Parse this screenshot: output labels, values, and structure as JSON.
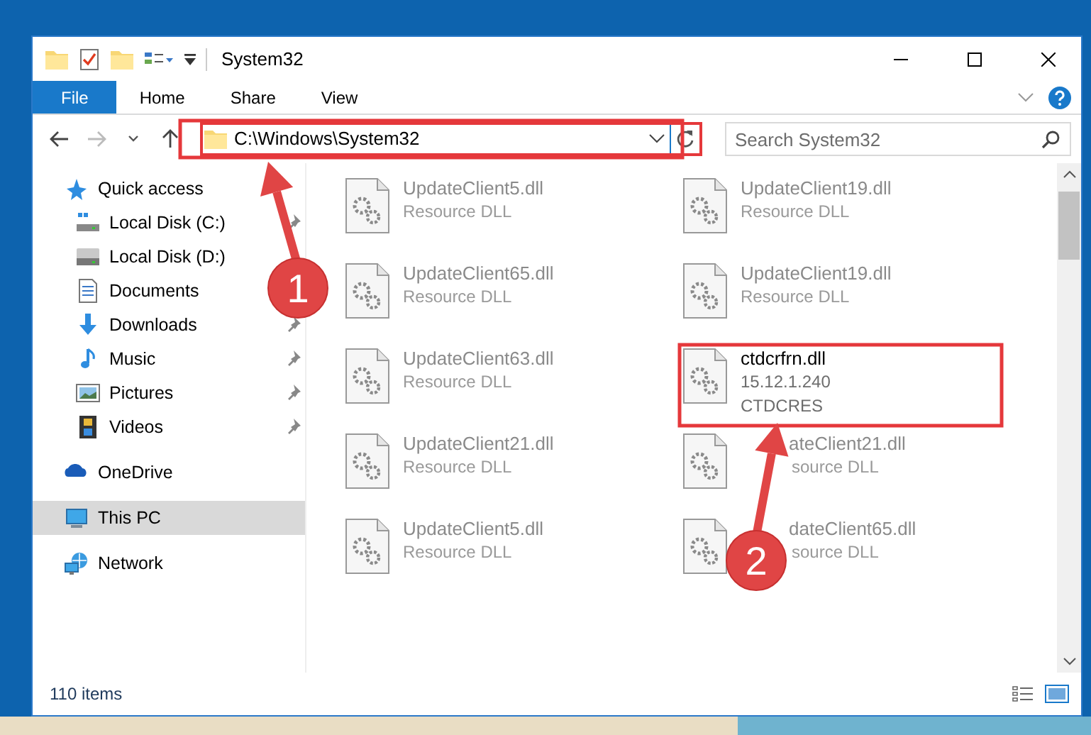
{
  "window": {
    "title": "System32"
  },
  "ribbon_tabs": [
    {
      "label": "File",
      "selected": true
    },
    {
      "label": "Home",
      "selected": false
    },
    {
      "label": "Share",
      "selected": false
    },
    {
      "label": "View",
      "selected": false
    }
  ],
  "address_bar": {
    "path": "C:\\Windows\\System32"
  },
  "search": {
    "placeholder": "Search System32"
  },
  "nav_items": [
    {
      "label": "Quick access",
      "selected": false,
      "children": [
        {
          "label": "Local Disk (C:)",
          "pinned": true
        },
        {
          "label": "Local Disk (D:)",
          "pinned": false
        },
        {
          "label": "Documents"
        },
        {
          "label": "Downloads",
          "pinned": true
        },
        {
          "label": "Music",
          "pinned": true
        },
        {
          "label": "Pictures",
          "pinned": true
        },
        {
          "label": "Videos",
          "pinned": true
        }
      ]
    },
    {
      "label": "OneDrive",
      "selected": false
    },
    {
      "label": "This PC",
      "selected": true
    },
    {
      "label": "Network",
      "selected": false
    }
  ],
  "files": [
    {
      "name": "UpdateClient5.dll",
      "details": [
        "Resource DLL"
      ],
      "blurred": true
    },
    {
      "name": "UpdateClient19.dll",
      "details": [
        "Resource DLL"
      ],
      "blurred": true
    },
    {
      "name": "UpdateClient65.dll",
      "details": [
        "Resource DLL"
      ],
      "blurred": true
    },
    {
      "name": "UpdateClient19.dll",
      "details": [
        "Resource DLL"
      ],
      "blurred": true
    },
    {
      "name": "UpdateClient63.dll",
      "details": [
        "Resource DLL"
      ],
      "blurred": true
    },
    {
      "name": "ctdcrfrn.dll",
      "details": [
        "15.12.1.240",
        "CTDCRES"
      ],
      "blurred": false
    },
    {
      "name": "UpdateClient21.dll",
      "details": [
        "Resource DLL"
      ],
      "blurred": true
    },
    {
      "name": "ateClient21.dll",
      "details": [
        "source DLL"
      ],
      "blurred": true,
      "partly_covered": true
    },
    {
      "name": "UpdateClient5.dll",
      "details": [
        "Resource DLL"
      ],
      "blurred": true
    },
    {
      "name": "dateClient65.dll",
      "details": [
        "source DLL"
      ],
      "blurred": true,
      "partly_covered": true
    }
  ],
  "status_bar": {
    "item_count": "110 items"
  },
  "annotations": [
    {
      "label": "1"
    },
    {
      "label": "2"
    }
  ]
}
